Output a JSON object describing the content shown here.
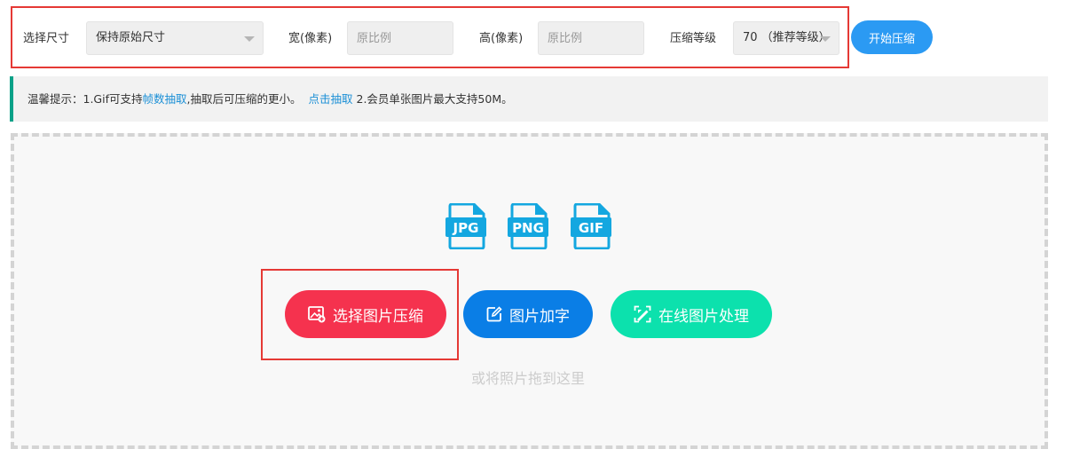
{
  "toolbar": {
    "size_label": "选择尺寸",
    "size_select_value": "保持原始尺寸",
    "width_label": "宽(像素)",
    "width_placeholder": "原比例",
    "height_label": "高(像素)",
    "height_placeholder": "原比例",
    "quality_label": "压缩等级",
    "quality_select_value": "70 （推荐等级）",
    "start_button": "开始压缩"
  },
  "tip": {
    "prefix": "温馨提示：1.Gif可支持",
    "link1": "帧数抽取",
    "middle": ",抽取后可压缩的更小。",
    "link2": "点击抽取",
    "suffix": " 2.会员单张图片最大支持50M。"
  },
  "formats": [
    "JPG",
    "PNG",
    "GIF"
  ],
  "actions": {
    "select_compress": "选择图片压缩",
    "add_text": "图片加字",
    "online_process": "在线图片处理"
  },
  "drop_hint": "或将照片拖到这里",
  "colors": {
    "accent_blue": "#2b9af3",
    "red_button": "#f5324e",
    "blue_button": "#0a7ee6",
    "green_button": "#0ce1ad",
    "file_icon": "#14a7e0",
    "tip_border": "#0aa188"
  }
}
